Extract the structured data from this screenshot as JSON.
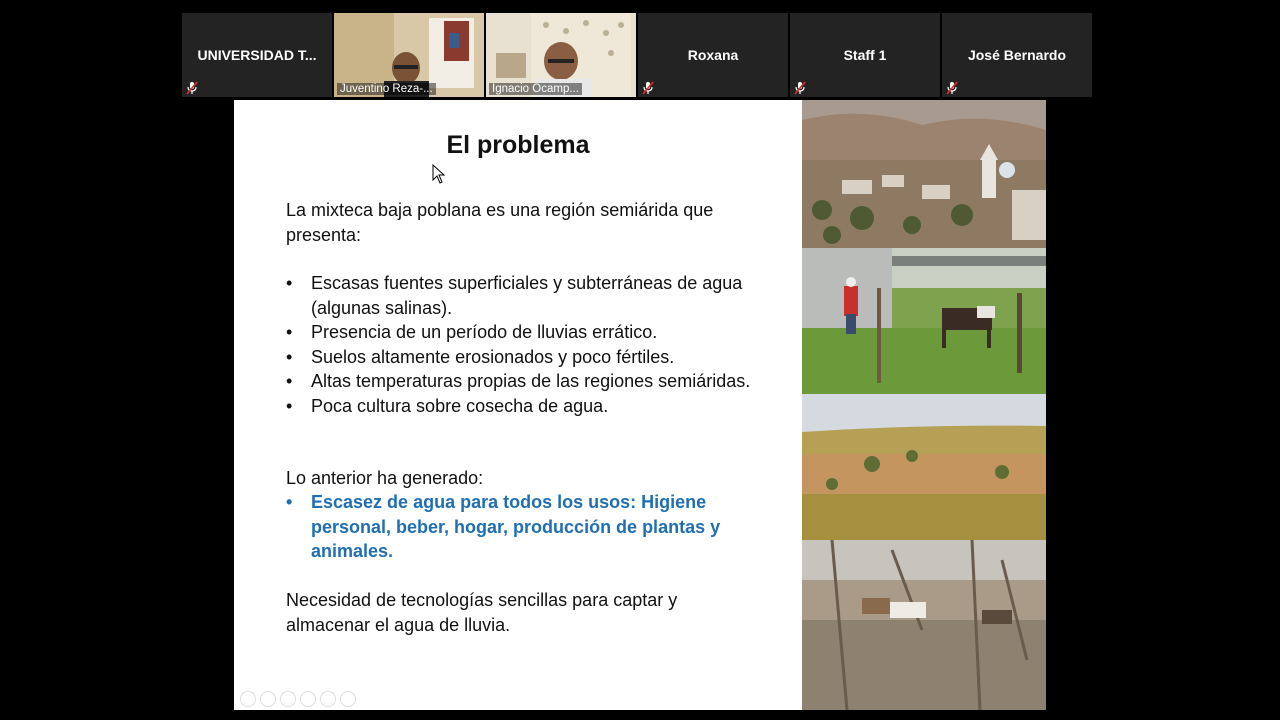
{
  "participants": [
    {
      "name": "UNIVERSIDAD T...",
      "video": false,
      "muted": true
    },
    {
      "name": "Juventino Reza-...",
      "video": true,
      "muted": true
    },
    {
      "name": "Ignacio Ocamp...",
      "video": true,
      "muted": false
    },
    {
      "name": "Roxana",
      "video": false,
      "muted": true
    },
    {
      "name": "Staff 1",
      "video": false,
      "muted": true
    },
    {
      "name": "José Bernardo",
      "video": false,
      "muted": true
    }
  ],
  "slide": {
    "title": "El problema",
    "intro": "La mixteca baja poblana es una región semiárida que presenta:",
    "bullets": [
      "Escasas fuentes superficiales y subterráneas de agua (algunas salinas).",
      "Presencia de un período de lluvias errático.",
      "Suelos altamente erosionados y poco fértiles.",
      "Altas temperaturas propias de las regiones semiáridas.",
      "Poca cultura sobre cosecha de agua."
    ],
    "consequence_label": "Lo anterior ha generado:",
    "consequence_bullets": [
      "Escasez de agua para todos los usos: Higiene personal, beber, hogar, producción de plantas y animales."
    ],
    "conclusion": "Necesidad de tecnologías sencillas para captar y almacenar el agua de lluvia.",
    "bullet_char": "•"
  },
  "colors": {
    "accent_blue": "#1f6fb2",
    "tile_bg": "#232323",
    "muted_red": "#d9302c"
  }
}
